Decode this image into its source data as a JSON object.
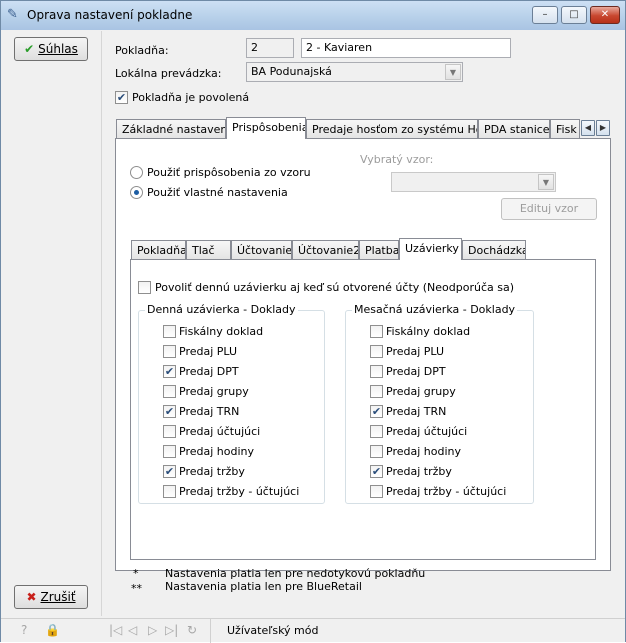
{
  "window": {
    "title": "Oprava nastavení pokladne",
    "min": "–",
    "max": "□",
    "close": "✕"
  },
  "sidebar": {
    "ok_label": "Súhlas",
    "cancel_label": "Zrušiť"
  },
  "form": {
    "pokladna_label": "Pokladňa:",
    "pokladna_id": "2",
    "pokladna_name": "2 - Kaviaren",
    "prevadzka_label": "Lokálna prevádzka:",
    "prevadzka_value": "BA Podunajská",
    "povolena_label": "Pokladňa je povolená",
    "povolena_checked": true
  },
  "main_tabs": [
    "Základné nastavenia",
    "Prispôsobenia",
    "Predaje hosťom zo systému Horec",
    "PDA stanice",
    "Fisk"
  ],
  "main_tab_active": "Prispôsobenia",
  "customize": {
    "radio_template": "Použiť prispôsobenia zo vzoru",
    "radio_own": "Použiť vlastné nastavenia",
    "selected": "own",
    "template_label": "Vybratý vzor:",
    "template_value": "",
    "edit_button": "Edituj vzor"
  },
  "sub_tabs": [
    "Pokladňa",
    "Tlač",
    "Účtovanie",
    "Účtovanie2",
    "Platba",
    "Uzávierky",
    "Dochádzka"
  ],
  "sub_tab_active": "Uzávierky",
  "uzavierky": {
    "allow_label": "Povoliť dennú uzávierku aj keď sú otvorené účty (Neodporúča sa)",
    "allow_checked": false,
    "daily_title": "Denná uzávierka - Doklady",
    "monthly_title": "Mesačná uzávierka - Doklady",
    "items": [
      "Fiskálny doklad",
      "Predaj PLU",
      "Predaj DPT",
      "Predaj grupy",
      "Predaj TRN",
      "Predaj účtujúci",
      "Predaj hodiny",
      "Predaj tržby",
      "Predaj tržby - účtujúci"
    ],
    "daily_checked": [
      false,
      false,
      true,
      false,
      true,
      false,
      false,
      true,
      false
    ],
    "monthly_checked": [
      false,
      false,
      false,
      false,
      true,
      false,
      false,
      true,
      false
    ]
  },
  "notes": [
    {
      "mark": "*",
      "text": "Nastavenia platia len pre nedotykovú pokladňu"
    },
    {
      "mark": "**",
      "text": "Nastavenia platia len pre BlueRetail"
    }
  ],
  "status": {
    "mode": "Užívateľský mód"
  },
  "icons": [
    "app-icon",
    "checkmark-icon",
    "cross-icon",
    "help-icon",
    "lock-icon",
    "first-record-icon",
    "prev-record-icon",
    "next-record-icon",
    "last-record-icon",
    "refresh-icon"
  ]
}
